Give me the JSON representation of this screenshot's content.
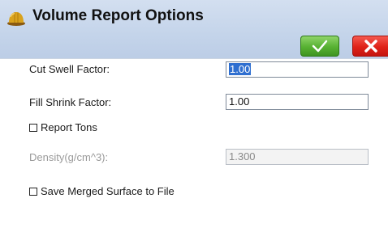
{
  "window": {
    "title": "Volume Report Options",
    "title_icon": "hard-hat-icon"
  },
  "toolbar": {
    "ok_icon": "checkmark-icon",
    "cancel_icon": "x-icon",
    "ok_color": "#57b132",
    "cancel_color": "#df2218"
  },
  "form": {
    "cut_swell": {
      "label": "Cut Swell Factor:",
      "value": "1.00",
      "selected": true
    },
    "fill_shrink": {
      "label": "Fill Shrink Factor:",
      "value": "1.00"
    },
    "report_tons": {
      "label": "Report Tons",
      "checked": false
    },
    "density": {
      "label": "Density(g/cm^3):",
      "value": "1.300",
      "enabled": false
    },
    "save_merged": {
      "label": "Save Merged Surface to File",
      "checked": false
    }
  }
}
